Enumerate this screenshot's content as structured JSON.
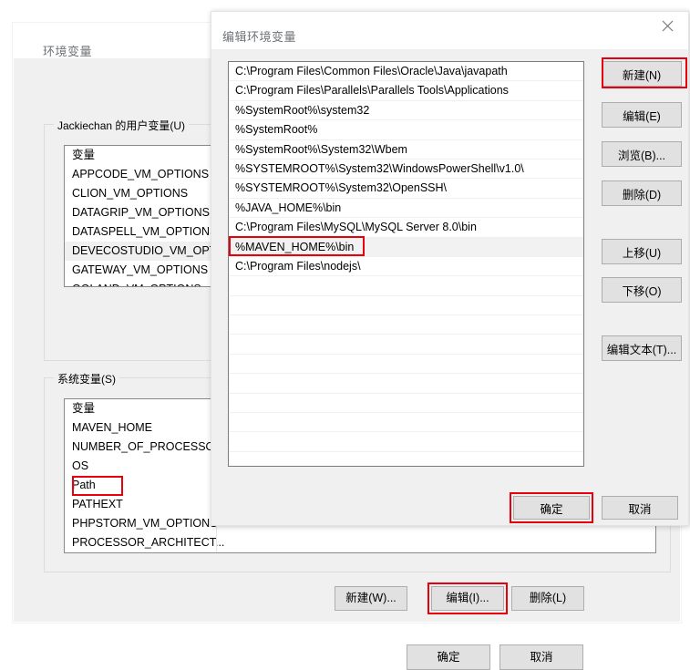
{
  "background_window": {
    "title": "环境变量",
    "user_section": {
      "legend": "Jackiechan 的用户变量(U)",
      "column_header": "变量",
      "rows": [
        "APPCODE_VM_OPTIONS",
        "CLION_VM_OPTIONS",
        "DATAGRIP_VM_OPTIONS",
        "DATASPELL_VM_OPTIONS",
        "DEVECOSTUDIO_VM_OPT...",
        "GATEWAY_VM_OPTIONS",
        "GOLAND_VM_OPTIONS"
      ],
      "selected_row_index": 4
    },
    "system_section": {
      "legend": "系统变量(S)",
      "column_header": "变量",
      "rows": [
        "MAVEN_HOME",
        "NUMBER_OF_PROCESSORS",
        "OS",
        "Path",
        "PATHEXT",
        "PHPSTORM_VM_OPTIONS",
        "PROCESSOR_ARCHITECT..."
      ],
      "highlighted_row_index": 3,
      "buttons": [
        {
          "label": "新建(W)...",
          "highlighted": false
        },
        {
          "label": "编辑(I)...",
          "highlighted": true
        },
        {
          "label": "删除(L)",
          "highlighted": false
        }
      ]
    },
    "footer_buttons": [
      {
        "label": "确定"
      },
      {
        "label": "取消"
      }
    ]
  },
  "dialog": {
    "title": "编辑环境变量",
    "close_icon": "close-icon",
    "path_entries": [
      "C:\\Program Files\\Common Files\\Oracle\\Java\\javapath",
      "C:\\Program Files\\Parallels\\Parallels Tools\\Applications",
      "%SystemRoot%\\system32",
      "%SystemRoot%",
      "%SystemRoot%\\System32\\Wbem",
      "%SYSTEMROOT%\\System32\\WindowsPowerShell\\v1.0\\",
      "%SYSTEMROOT%\\System32\\OpenSSH\\",
      "%JAVA_HOME%\\bin",
      "C:\\Program Files\\MySQL\\MySQL Server 8.0\\bin",
      "%MAVEN_HOME%\\bin",
      "C:\\Program Files\\nodejs\\"
    ],
    "selected_entry_index": 9,
    "highlighted_entry_index": 9,
    "side_buttons": [
      {
        "label": "新建(N)",
        "highlighted": true
      },
      {
        "label": "编辑(E)",
        "highlighted": false
      },
      {
        "label": "浏览(B)...",
        "highlighted": false
      },
      {
        "label": "删除(D)",
        "highlighted": false
      },
      {
        "label": "上移(U)",
        "highlighted": false
      },
      {
        "label": "下移(O)",
        "highlighted": false
      },
      {
        "label": "编辑文本(T)...",
        "highlighted": false
      }
    ],
    "footer_buttons": [
      {
        "label": "确定",
        "highlighted": true
      },
      {
        "label": "取消",
        "highlighted": false
      }
    ]
  },
  "colors": {
    "annotation": "#e8000d",
    "title_text": "#6f7378",
    "dialog_bg": "#f0f0f0",
    "button_face": "#e1e1e1",
    "button_border": "#adadad",
    "listbox_border": "#7a7a82"
  }
}
